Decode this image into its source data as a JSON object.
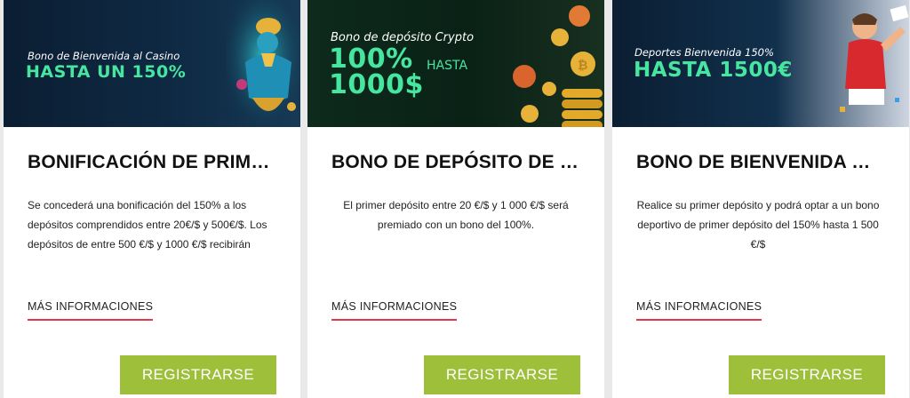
{
  "cards": [
    {
      "banner_subtitle": "Bono de Bienvenida al Casino",
      "banner_headline": "HASTA UN 150%",
      "title": "BONIFICACIÓN DE PRIM…",
      "description": "Se concederá una bonificación del 150% a los depósitos comprendidos entre 20€/$ y 500€/$. Los depósitos de entre 500 €/$ y 1000 €/$ recibirán",
      "more_label": "MÁS INFORMACIONES",
      "register_label": "REGISTRARSE"
    },
    {
      "banner_subtitle": "Bono de depósito Crypto",
      "banner_headline": "100% 1000$",
      "banner_headline_line1": "100%",
      "banner_headline_line2": "1000$",
      "banner_hasta": "HASTA",
      "title": "BONO DE DEPÓSITO DE …",
      "description": "El primer depósito entre 20 €/$ y 1 000 €/$ será premiado con un bono del 100%.",
      "more_label": "MÁS INFORMACIONES",
      "register_label": "REGISTRARSE"
    },
    {
      "banner_subtitle": "Deportes Bienvenida 150%",
      "banner_headline": "HASTA 1500€",
      "title": "BONO DE BIENVENIDA …",
      "description": "Realice su primer depósito y podrá optar a un bono deportivo de primer depósito del 150% hasta 1 500 €/$",
      "more_label": "MÁS INFORMACIONES",
      "register_label": "REGISTRARSE"
    }
  ],
  "colors": {
    "accent_green": "#46e6a0",
    "button_green": "#9dbf3a",
    "underline_red": "#e0384a",
    "page_bg": "#e9e9ea"
  },
  "icons": [
    "genie-character-art",
    "crypto-coins-art",
    "footballer-character-art"
  ]
}
